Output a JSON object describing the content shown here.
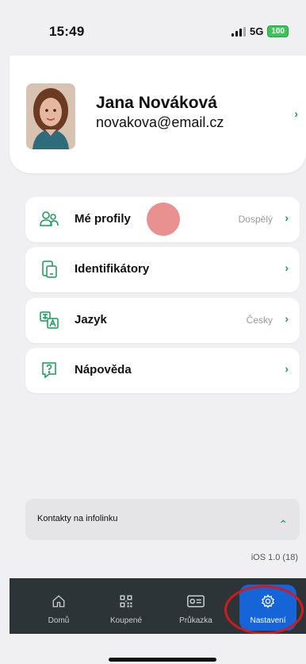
{
  "status": {
    "time": "15:49",
    "network": "5G",
    "battery": "100"
  },
  "profile": {
    "name": "Jana Nováková",
    "email": "novakova@email.cz"
  },
  "menu": [
    {
      "label": "Mé profily",
      "value": "Dospělý",
      "icon": "profiles-icon"
    },
    {
      "label": "Identifikátory",
      "value": "",
      "icon": "identifier-device-icon"
    },
    {
      "label": "Jazyk",
      "value": "Česky",
      "icon": "language-icon"
    },
    {
      "label": "Nápověda",
      "value": "",
      "icon": "help-icon"
    }
  ],
  "contacts": {
    "label": "Kontakty na infolinku"
  },
  "version": "iOS 1.0 (18)",
  "tabs": [
    {
      "label": "Domů",
      "icon": "home-icon"
    },
    {
      "label": "Koupené",
      "icon": "qr-code-icon"
    },
    {
      "label": "Průkazka",
      "icon": "id-card-icon"
    },
    {
      "label": "Nastavení",
      "icon": "gear-icon"
    }
  ],
  "colors": {
    "accent": "#1a9a57",
    "tab_active": "#1565d8",
    "tab_bar": "#2d3438",
    "highlight": "#d11a1a"
  }
}
